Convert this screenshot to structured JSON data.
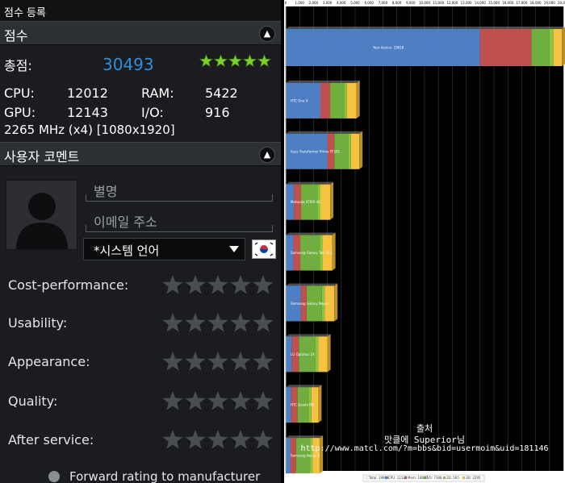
{
  "app": {
    "title": "점수 등록"
  },
  "score_section": {
    "heading": "점수",
    "total_label": "총점:",
    "total_value": "30493",
    "stars": 5,
    "cpu_label": "CPU:",
    "cpu_value": "12012",
    "ram_label": "RAM:",
    "ram_value": "5422",
    "gpu_label": "GPU:",
    "gpu_value": "12143",
    "io_label": "I/O:",
    "io_value": "916",
    "spec": "2265 MHz (x4) [1080x1920]"
  },
  "comment_section": {
    "heading": "사용자 코멘트",
    "nickname_placeholder": "별명",
    "email_placeholder": "이메일 주소",
    "language_selected": "*시스템 언어",
    "ratings": [
      {
        "label": "Cost-performance:",
        "stars": 0
      },
      {
        "label": "Usability:",
        "stars": 0
      },
      {
        "label": "Appearance:",
        "stars": 0
      },
      {
        "label": "Quality:",
        "stars": 0
      },
      {
        "label": "After service:",
        "stars": 0
      }
    ],
    "forward_label": "Forward rating to manufacturer"
  },
  "colors": {
    "score_blue": "#2f8fdc",
    "star_green": "#7ed02a",
    "bar_blue": "#4e7fc2",
    "bar_red": "#c0504d",
    "bar_green": "#6fae3f",
    "bar_yellow": "#f5c242"
  },
  "source": {
    "line1": "출처",
    "line2": "맛클에 Superior님",
    "line3": "http://www.matcl.com/?m=bbs&bid=usermoim&uid=181146"
  },
  "chart_data": {
    "type": "bar",
    "orientation": "horizontal",
    "stacked": true,
    "xlim": [
      0,
      20000
    ],
    "x_ticks": [
      "0",
      "1,000",
      "2,000",
      "3,000",
      "4,000",
      "5,000",
      "6,000",
      "7,000",
      "8,000",
      "9,000",
      "10,000",
      "11,000",
      "12,000",
      "13,000",
      "14,000",
      "15,000",
      "16,000",
      "17,000",
      "18,000",
      "19,000",
      "20,000"
    ],
    "categories": [
      "Your device: 19918",
      "HTC One X",
      "Asus Transformer Prime TF201",
      "Motorola ATRIX 4G",
      "Samsung Galaxy Tab 10.1",
      "Samsung Galaxy Nexus",
      "LG Optimus 2X",
      "HTC Desire HD",
      "Samsung Nexus S"
    ],
    "series": [
      {
        "name": "CPU",
        "values": [
          14000,
          2500,
          3000,
          600,
          550,
          1100,
          450,
          400,
          350
        ]
      },
      {
        "name": "Mem",
        "values": [
          3700,
          700,
          500,
          500,
          500,
          400,
          500,
          450,
          400
        ]
      },
      {
        "name": "I/O",
        "values": [
          1300,
          1000,
          1000,
          1200,
          1400,
          1100,
          1200,
          800,
          1000
        ]
      },
      {
        "name": "2D",
        "values": [
          300,
          200,
          200,
          200,
          200,
          200,
          200,
          200,
          200
        ]
      },
      {
        "name": "3D",
        "values": [
          600,
          700,
          600,
          700,
          700,
          700,
          650,
          500,
          500
        ]
      }
    ],
    "legend": [
      "Total: 19918",
      "CPU: 12122",
      "Mem: 18607",
      "I/O: 7388",
      "2D: 565",
      "3D: 2295"
    ],
    "legend_position": "bottom"
  }
}
